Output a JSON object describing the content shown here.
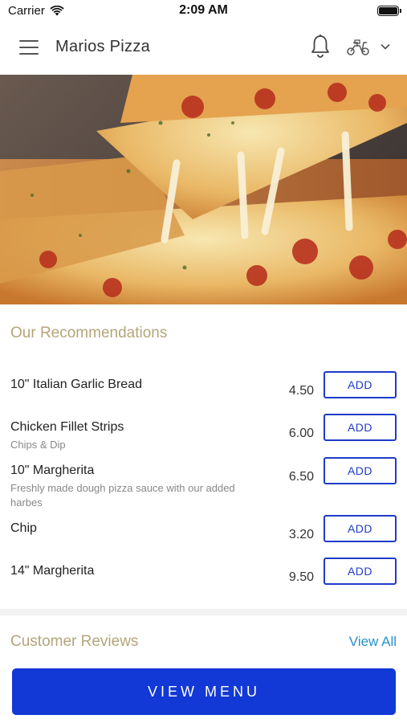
{
  "status_bar": {
    "carrier": "Carrier",
    "time": "2:09 AM"
  },
  "header": {
    "title": "Marios Pizza",
    "icons": [
      "menu-icon",
      "bell-icon",
      "scooter-icon",
      "chevron-down-icon"
    ]
  },
  "recommendations": {
    "title": "Our Recommendations",
    "add_label": "ADD",
    "items": [
      {
        "name": "10\" Italian Garlic Bread",
        "description": "",
        "price": "4.50"
      },
      {
        "name": "Chicken Fillet Strips",
        "description": "Chips & Dip",
        "price": "6.00"
      },
      {
        "name": "10\" Margherita",
        "description": "Freshly made dough pizza sauce with our added harbes",
        "price": "6.50"
      },
      {
        "name": "Chip",
        "description": "",
        "price": "3.20"
      },
      {
        "name": "14\" Margherita",
        "description": "",
        "price": "9.50"
      }
    ]
  },
  "reviews": {
    "title": "Customer Reviews",
    "view_all": "View All"
  },
  "footer": {
    "view_menu": "VIEW MENU"
  },
  "colors": {
    "accent_blue": "#1238d6",
    "section_title": "#b5a47a",
    "link": "#2a8fc7"
  }
}
